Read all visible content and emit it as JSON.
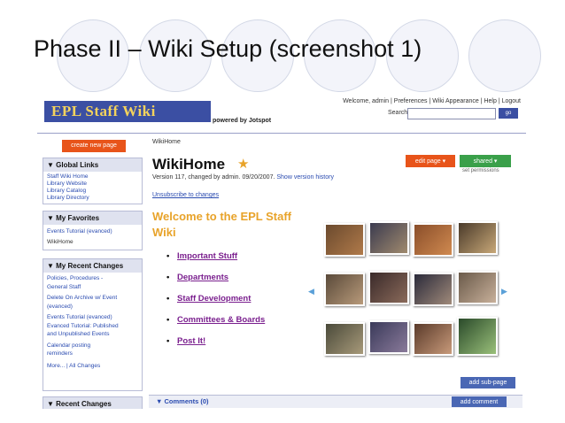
{
  "slide": {
    "title": "Phase II – Wiki Setup (screenshot 1)"
  },
  "header": {
    "logo": "EPL Staff Wiki",
    "powered_by": "powered by Jotspot",
    "welcome": "Welcome, admin | Preferences | Wiki Appearance | Help | Logout",
    "search_label": "Search:",
    "search_value": "",
    "go_label": "go"
  },
  "sidebar": {
    "create_label": "create new page",
    "global_links": {
      "title": "▼ Global Links",
      "items": [
        "Staff Wiki Home",
        "Library Website",
        "Library Catalog",
        "Library Directory"
      ]
    },
    "favorites": {
      "title": "▼ My Favorites",
      "items": [
        "Events Tutorial (evanced)",
        "WikiHome"
      ]
    },
    "recent": {
      "title": "▼ My Recent Changes",
      "items": [
        "Policies, Procedures -",
        "General Staff",
        "Delete On Archive w/ Event",
        "(evanced)",
        "Events Tutorial (evanced)",
        "Evanced Tutorial: Published",
        "and Unpublished Events",
        "Calendar posting",
        "reminders"
      ],
      "more": "More... | All Changes"
    },
    "recent2": {
      "title": "▼ Recent Changes"
    }
  },
  "main": {
    "breadcrumb": "WikiHome",
    "title": "WikiHome",
    "meta": "Version 117, changed by admin. 09/20/2007.",
    "meta_link": "Show version history",
    "unsubscribe": "Unsubscribe to changes",
    "edit_label": "edit page ▾",
    "shared_label": "shared ▾",
    "perm_label": "set permissions",
    "welcome_heading": "Welcome to the EPL Staff Wiki",
    "links": [
      "Important Stuff",
      "Departments",
      "Staff Development",
      "Committees & Boards",
      "Post It!"
    ],
    "add_subpage": "add sub-page",
    "comments": "▼ Comments (0)",
    "add_comment": "add comment"
  },
  "colors": {
    "accent": "#e8541a",
    "brand": "#3b4fa3",
    "link": "#2a4bb0",
    "heading": "#e8a32a",
    "visited": "#7a1f8e",
    "green": "#3aa04a"
  },
  "icons": {
    "star": "star-icon",
    "left_arrow": "left-arrow-icon",
    "right_arrow": "right-arrow-icon"
  }
}
